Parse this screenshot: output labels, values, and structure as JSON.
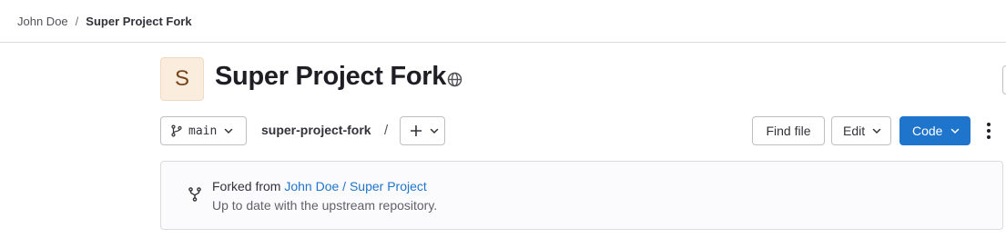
{
  "breadcrumb": {
    "owner": "John Doe",
    "separator": "/",
    "project": "Super Project Fork"
  },
  "project": {
    "avatar_letter": "S",
    "title": "Super Project Fork",
    "visibility_icon": "globe-icon"
  },
  "toolbar": {
    "branch": "main",
    "repo_path": "super-project-fork",
    "path_separator": "/",
    "find_file_label": "Find file",
    "edit_label": "Edit",
    "code_label": "Code"
  },
  "fork_info": {
    "prefix": "Forked from ",
    "source_link": "John Doe / Super Project",
    "status": "Up to date with the upstream repository."
  },
  "colors": {
    "primary": "#1f75cb",
    "avatar_bg": "#fbeddd"
  }
}
